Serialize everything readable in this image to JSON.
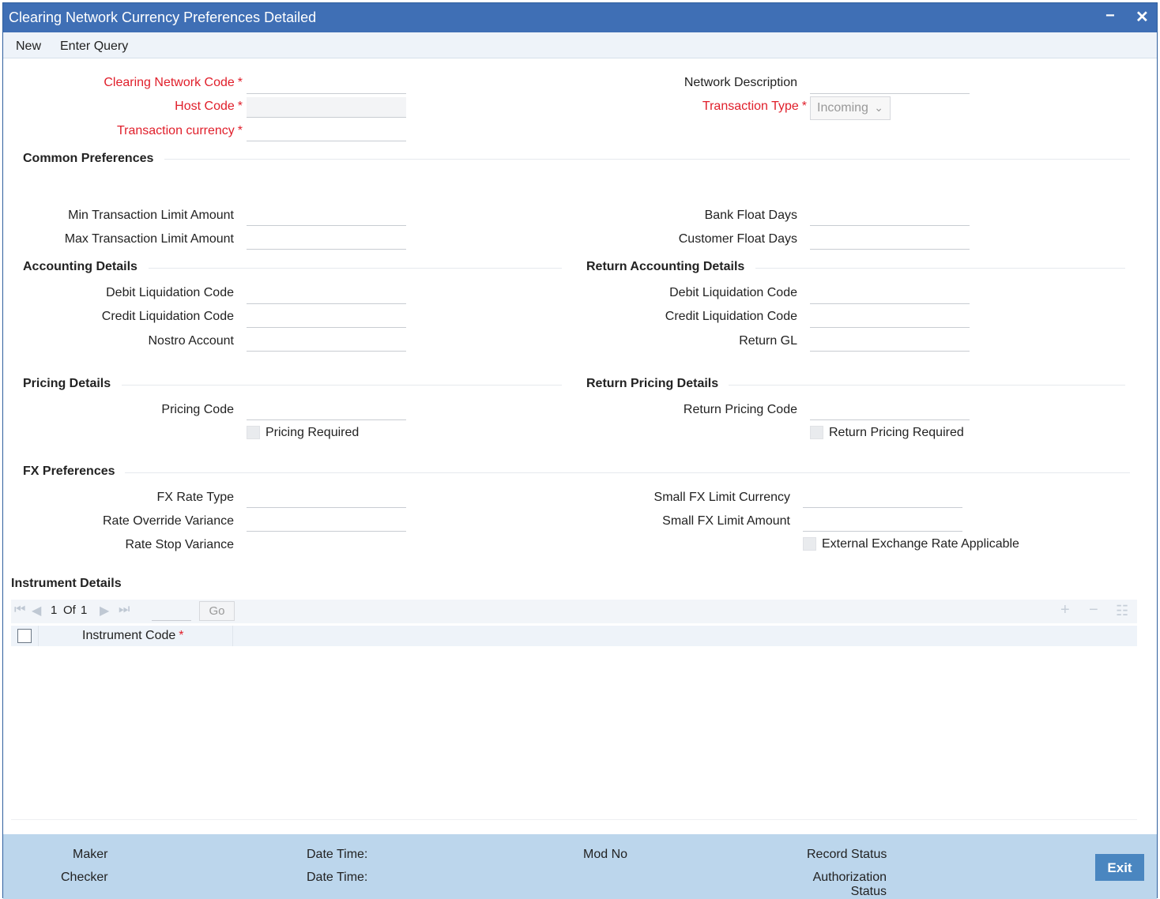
{
  "window": {
    "title": "Clearing Network Currency Preferences Detailed",
    "minimize": "−",
    "close": "✕"
  },
  "menu": {
    "new": "New",
    "enter_query": "Enter Query"
  },
  "header": {
    "clearing_network_code": "Clearing Network Code",
    "host_code": "Host Code",
    "transaction_currency": "Transaction currency",
    "network_description": "Network Description",
    "transaction_type": "Transaction Type",
    "transaction_type_value": "Incoming",
    "required_mark": "*"
  },
  "common": {
    "title": "Common Preferences",
    "min_limit": "Min Transaction Limit Amount",
    "max_limit": "Max Transaction Limit Amount",
    "bank_float_days": "Bank Float Days",
    "customer_float_days": "Customer Float Days"
  },
  "accounting": {
    "title": "Accounting Details",
    "debit_liq": "Debit Liquidation Code",
    "credit_liq": "Credit Liquidation Code",
    "nostro": "Nostro Account"
  },
  "return_accounting": {
    "title": "Return Accounting Details",
    "debit_liq": "Debit Liquidation Code",
    "credit_liq": "Credit Liquidation Code",
    "return_gl": "Return GL"
  },
  "pricing": {
    "title": "Pricing Details",
    "code": "Pricing Code",
    "required": "Pricing Required"
  },
  "return_pricing": {
    "title": "Return Pricing Details",
    "code": "Return Pricing Code",
    "required": "Return Pricing Required"
  },
  "fx": {
    "title": "FX Preferences",
    "rate_type": "FX Rate Type",
    "override_variance": "Rate Override Variance",
    "stop_variance": "Rate Stop Variance",
    "small_fx_currency": "Small FX Limit Currency",
    "small_fx_amount": "Small FX Limit Amount",
    "external_rate": "External Exchange Rate Applicable"
  },
  "instrument": {
    "title": "Instrument Details",
    "page_current": "1",
    "page_of": "Of",
    "page_total": "1",
    "go": "Go",
    "col_code": "Instrument Code",
    "required_mark": "*"
  },
  "footer": {
    "maker": "Maker",
    "checker": "Checker",
    "date_time": "Date Time:",
    "mod_no": "Mod No",
    "record_status": "Record Status",
    "auth_status_1": "Authorization",
    "auth_status_2": "Status",
    "exit": "Exit"
  }
}
